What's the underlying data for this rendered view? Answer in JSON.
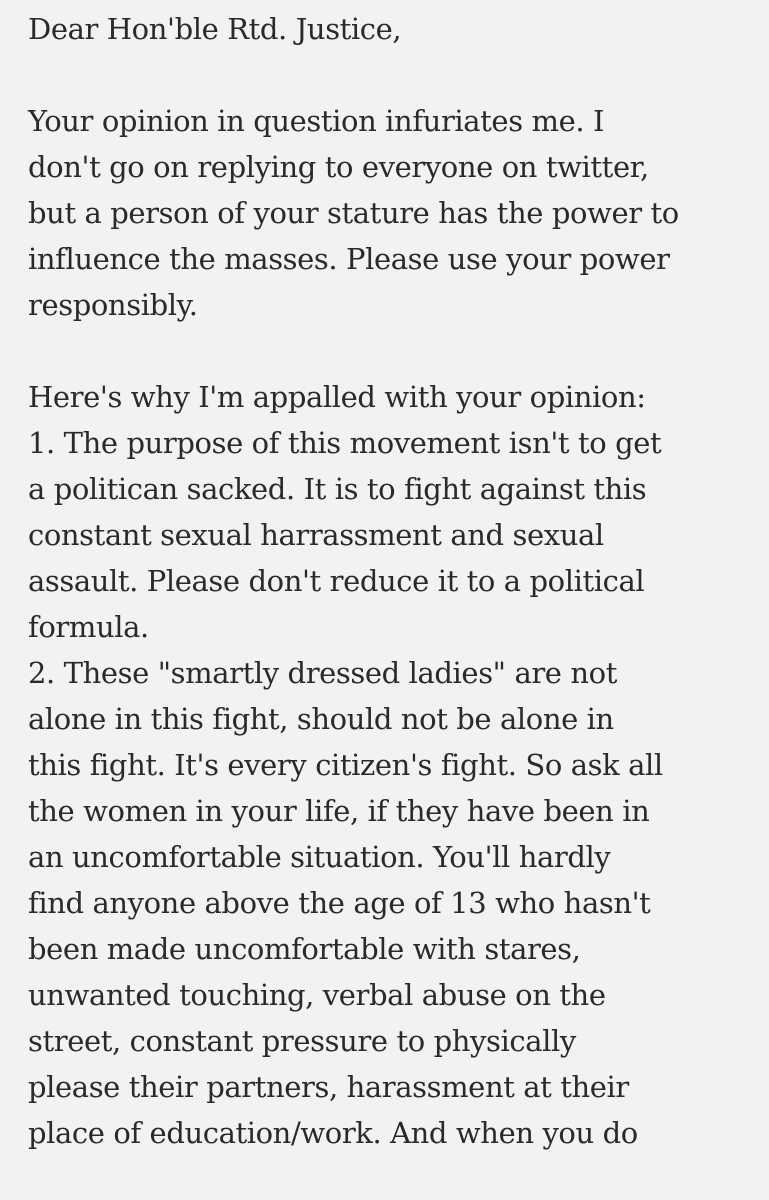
{
  "note": {
    "salutation": "Dear Hon'ble Rtd. Justice,",
    "paragraph1": [
      "Your opinion in question infuriates me. I",
      "don't go on replying to everyone on twitter,",
      "but a person of your stature has the power to",
      "influence the masses. Please use your power",
      "responsibly."
    ],
    "paragraph2": [
      "Here's why I'm appalled with your opinion:",
      "1. The purpose of this movement isn't to get",
      "a politican sacked. It is to fight against this",
      "constant sexual harrassment and sexual",
      "assault. Please don't reduce it to a political",
      "formula.",
      "2. These \"smartly dressed ladies\" are not",
      "alone in this fight, should not be alone in",
      "this fight. It's every citizen's fight. So ask all",
      "the women in your life, if they have been in",
      "an uncomfortable situation. You'll hardly",
      "find anyone above the age of 13 who hasn't",
      "been made uncomfortable with stares,",
      "unwanted touching, verbal abuse on the",
      "street, constant pressure to physically",
      "please their partners, harassment at their",
      "place of education/work. And when you do"
    ]
  }
}
